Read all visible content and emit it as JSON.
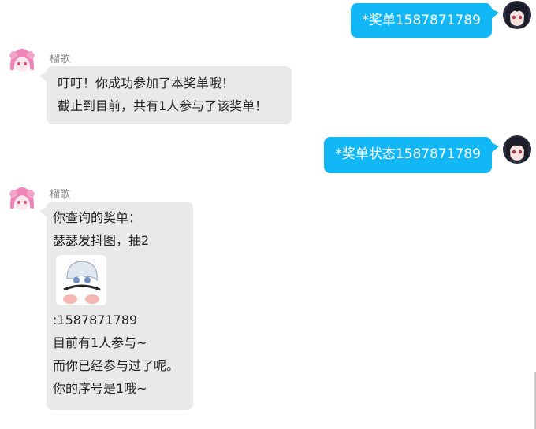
{
  "messages": [
    {
      "side": "user",
      "text": "*奖单1587871789"
    },
    {
      "side": "bot",
      "sender": "榴歌",
      "lines": [
        "叮叮！你成功参加了本奖单哦！",
        "截止到目前，共有1人参与了该奖单！"
      ]
    },
    {
      "side": "user",
      "text": "*奖单状态1587871789"
    },
    {
      "side": "bot",
      "sender": "榴歌",
      "lines_before_image": [
        "你查询的奖单：",
        "瑟瑟发抖图，抽2"
      ],
      "lines_after_image": [
        ":1587871789",
        "目前有1人参与~",
        "而你已经参与过了呢。",
        "你的序号是1哦~"
      ]
    }
  ],
  "icons": {
    "user_avatar": "anime-girl-dark-hair-avatar",
    "bot_avatar": "anime-girl-pink-hair-avatar",
    "prize_image": "anime-character-sticker-image"
  },
  "colors": {
    "user_bubble": "#12b7f5",
    "bot_bubble": "#e9e9e9"
  }
}
